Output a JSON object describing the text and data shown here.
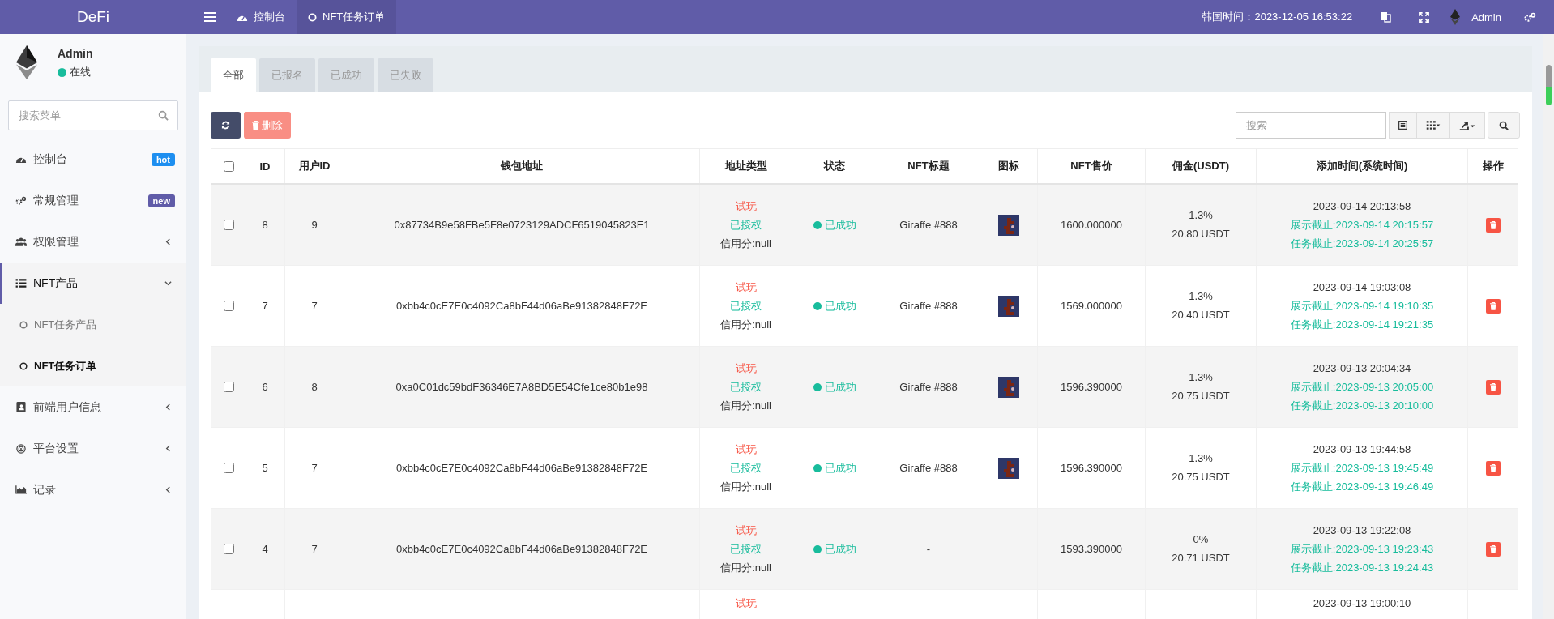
{
  "topbar": {
    "logo": "DeFi",
    "tabs": [
      {
        "label": "控制台",
        "selected": false
      },
      {
        "label": "NFT任务订单",
        "selected": true
      }
    ],
    "clock": "韩国时间：2023-12-05 16:53:22",
    "user": "Admin"
  },
  "sidebar": {
    "user": {
      "name": "Admin",
      "status": "在线"
    },
    "search": {
      "placeholder": "搜索菜单"
    },
    "items": [
      {
        "label": "控制台",
        "kind": "link",
        "badge": "hot",
        "color": "#1e8ff0",
        "expanded": false
      },
      {
        "label": "常规管理",
        "kind": "link",
        "badge": "new",
        "color": "#605ca8",
        "expanded": false
      },
      {
        "label": "权限管理",
        "kind": "group",
        "expanded": false
      },
      {
        "label": "NFT产品",
        "kind": "group",
        "expanded": true,
        "children": [
          {
            "label": "NFT任务产品",
            "selected": false
          },
          {
            "label": "NFT任务订单",
            "selected": true
          }
        ]
      },
      {
        "label": "前端用户信息",
        "kind": "group",
        "expanded": false
      },
      {
        "label": "平台设置",
        "kind": "group",
        "expanded": false
      },
      {
        "label": "记录",
        "kind": "group",
        "expanded": false
      }
    ]
  },
  "panel": {
    "tabs": [
      {
        "label": "全部",
        "selected": true
      },
      {
        "label": "已报名",
        "selected": false
      },
      {
        "label": "已成功",
        "selected": false
      },
      {
        "label": "已失败",
        "selected": false
      }
    ],
    "toolbar": {
      "delete_label": "删除",
      "search_placeholder": "搜索"
    },
    "table": {
      "select_all_checked": false,
      "columns": [
        "ID",
        "用户ID",
        "钱包地址",
        "地址类型",
        "状态",
        "NFT标题",
        "图标",
        "NFT售价",
        "佣金(USDT)",
        "添加时间(系统时间)",
        "操作"
      ],
      "rows": [
        {
          "checked": false,
          "id": "8",
          "user_id": "9",
          "wallet": "0x87734B9e58FBe5F8e0723129ADCF6519045823E1",
          "type_lines": [
            {
              "text": "试玩",
              "kind": "trial"
            },
            {
              "text": "已授权",
              "kind": "authorized"
            },
            {
              "text": "信用分:null",
              "kind": "credit"
            }
          ],
          "status": {
            "text": "已成功",
            "kind": "success"
          },
          "title": "Giraffe #888",
          "image": true,
          "price": "1600.000000",
          "rate": "1.3%",
          "commission": "20.80 USDT",
          "added": "2023-09-14 20:13:58",
          "show_deadline": "展示截止:2023-09-14 20:15:57",
          "task_deadline": "任务截止:2023-09-14 20:25:57"
        },
        {
          "checked": false,
          "id": "7",
          "user_id": "7",
          "wallet": "0xbb4c0cE7E0c4092Ca8bF44d06aBe91382848F72E",
          "type_lines": [
            {
              "text": "试玩",
              "kind": "trial"
            },
            {
              "text": "已授权",
              "kind": "authorized"
            },
            {
              "text": "信用分:null",
              "kind": "credit"
            }
          ],
          "status": {
            "text": "已成功",
            "kind": "success"
          },
          "title": "Giraffe #888",
          "image": true,
          "price": "1569.000000",
          "rate": "1.3%",
          "commission": "20.40 USDT",
          "added": "2023-09-14 19:03:08",
          "show_deadline": "展示截止:2023-09-14 19:10:35",
          "task_deadline": "任务截止:2023-09-14 19:21:35"
        },
        {
          "checked": false,
          "id": "6",
          "user_id": "8",
          "wallet": "0xa0C01dc59bdF36346E7A8BD5E54Cfe1ce80b1e98",
          "type_lines": [
            {
              "text": "试玩",
              "kind": "trial"
            },
            {
              "text": "已授权",
              "kind": "authorized"
            },
            {
              "text": "信用分:null",
              "kind": "credit"
            }
          ],
          "status": {
            "text": "已成功",
            "kind": "success"
          },
          "title": "Giraffe #888",
          "image": true,
          "price": "1596.390000",
          "rate": "1.3%",
          "commission": "20.75 USDT",
          "added": "2023-09-13 20:04:34",
          "show_deadline": "展示截止:2023-09-13 20:05:00",
          "task_deadline": "任务截止:2023-09-13 20:10:00"
        },
        {
          "checked": false,
          "id": "5",
          "user_id": "7",
          "wallet": "0xbb4c0cE7E0c4092Ca8bF44d06aBe91382848F72E",
          "type_lines": [
            {
              "text": "试玩",
              "kind": "trial"
            },
            {
              "text": "已授权",
              "kind": "authorized"
            },
            {
              "text": "信用分:null",
              "kind": "credit"
            }
          ],
          "status": {
            "text": "已成功",
            "kind": "success"
          },
          "title": "Giraffe #888",
          "image": true,
          "price": "1596.390000",
          "rate": "1.3%",
          "commission": "20.75 USDT",
          "added": "2023-09-13 19:44:58",
          "show_deadline": "展示截止:2023-09-13 19:45:49",
          "task_deadline": "任务截止:2023-09-13 19:46:49"
        },
        {
          "checked": false,
          "id": "4",
          "user_id": "7",
          "wallet": "0xbb4c0cE7E0c4092Ca8bF44d06aBe91382848F72E",
          "type_lines": [
            {
              "text": "试玩",
              "kind": "trial"
            },
            {
              "text": "已授权",
              "kind": "authorized"
            },
            {
              "text": "信用分:null",
              "kind": "credit"
            }
          ],
          "status": {
            "text": "已成功",
            "kind": "success"
          },
          "title": "-",
          "image": false,
          "price": "1593.390000",
          "rate": "0%",
          "commission": "20.71 USDT",
          "added": "2023-09-13 19:22:08",
          "show_deadline": "展示截止:2023-09-13 19:23:43",
          "task_deadline": "任务截止:2023-09-13 19:24:43"
        },
        {
          "type_lines": [
            {
              "text": "试玩",
              "kind": "trial"
            }
          ],
          "added": "2023-09-13 19:00:10"
        }
      ]
    }
  }
}
